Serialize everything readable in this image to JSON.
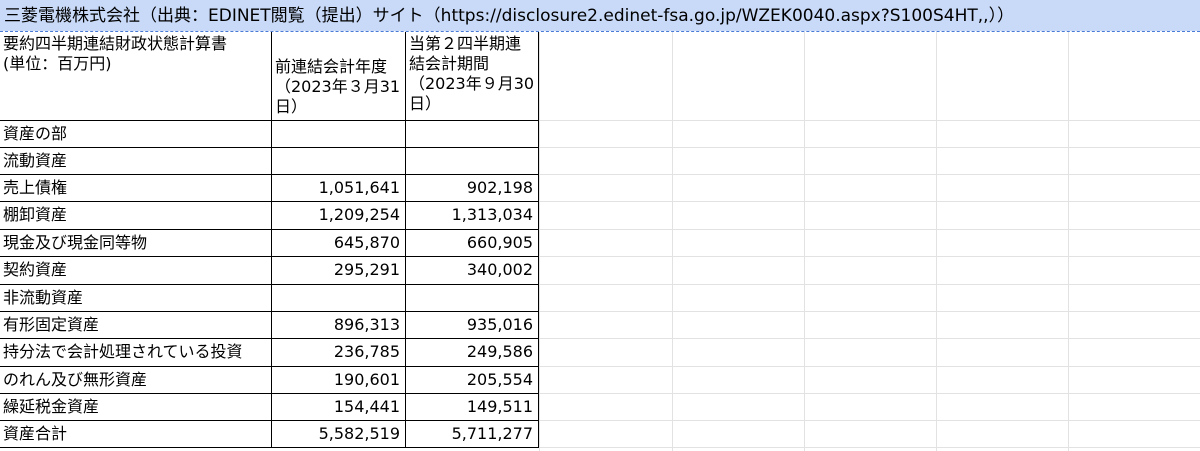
{
  "title": "三菱電機株式会社（出典：EDINET閲覧（提出）サイト（https://disclosure2.edinet-fsa.go.jp/WZEK0040.aspx?S100S4HT,,））",
  "header": {
    "col0_line1": "要約四半期連結財政状態計算書",
    "col0_line2": "(単位：百万円)",
    "col1": "前連結会計年度（2023年３月31日）",
    "col2": "当第２四半期連結会計期間（2023年９月30日）"
  },
  "rows": [
    {
      "label": "資産の部",
      "prev": "",
      "curr": ""
    },
    {
      "label": "流動資産",
      "prev": "",
      "curr": ""
    },
    {
      "label": "売上債権",
      "prev": "1,051,641",
      "curr": "902,198"
    },
    {
      "label": "棚卸資産",
      "prev": "1,209,254",
      "curr": "1,313,034"
    },
    {
      "label": "現金及び現金同等物",
      "prev": "645,870",
      "curr": "660,905"
    },
    {
      "label": "契約資産",
      "prev": "295,291",
      "curr": "340,002"
    },
    {
      "label": "非流動資産",
      "prev": "",
      "curr": ""
    },
    {
      "label": "有形固定資産",
      "prev": "896,313",
      "curr": "935,016"
    },
    {
      "label": "持分法で会計処理されている投資",
      "prev": "236,785",
      "curr": "249,586"
    },
    {
      "label": "のれん及び無形資産",
      "prev": "190,601",
      "curr": "205,554"
    },
    {
      "label": "繰延税金資産",
      "prev": "154,441",
      "curr": "149,511"
    },
    {
      "label": "資産合計",
      "prev": "5,582,519",
      "curr": "5,711,277"
    }
  ]
}
